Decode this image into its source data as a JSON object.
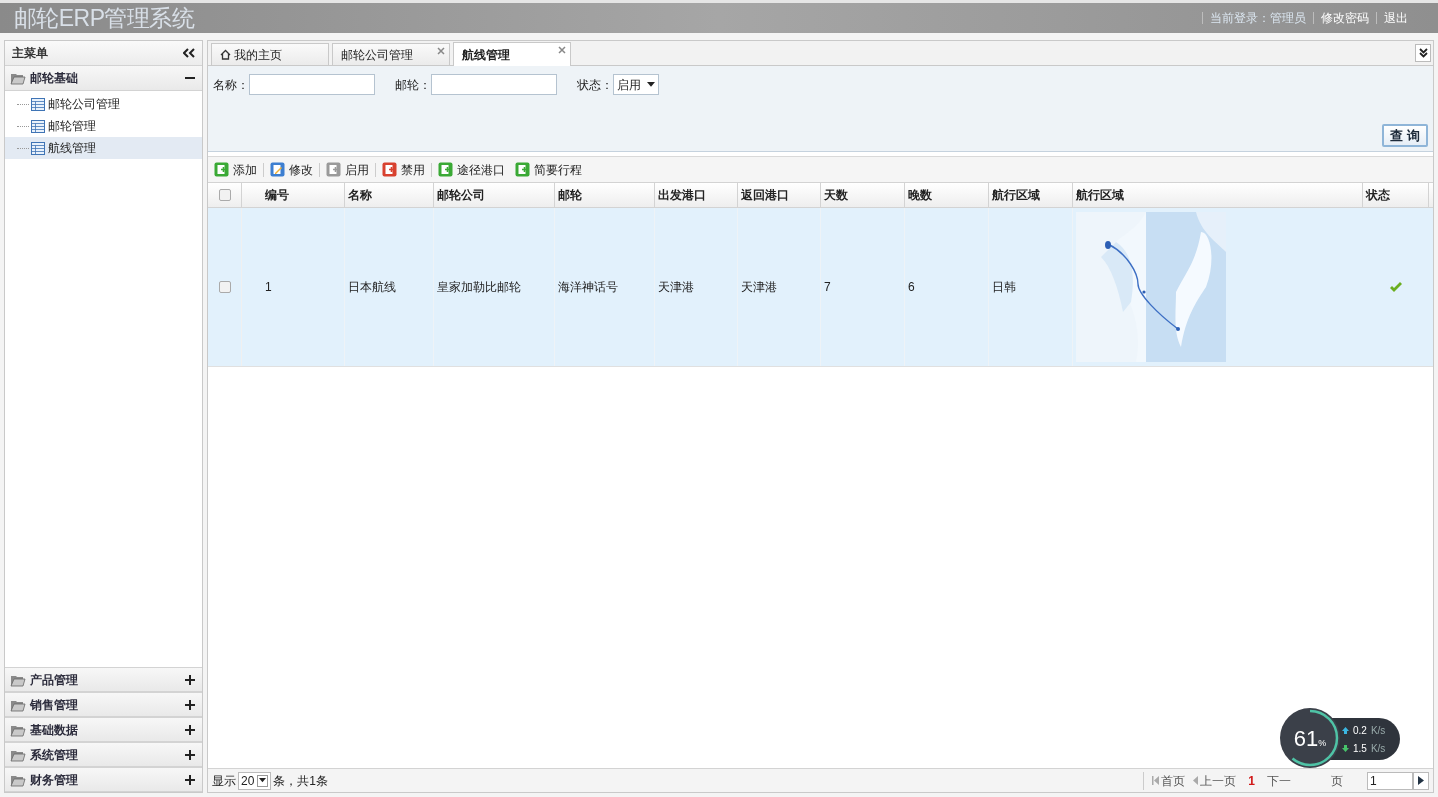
{
  "header": {
    "title": "邮轮ERP管理系统",
    "user_label": "当前登录：管理员",
    "links": [
      "修改密码",
      "退出"
    ]
  },
  "sidebar": {
    "title": "主菜单",
    "groups": [
      {
        "label": "邮轮基础",
        "expanded": true,
        "items": [
          {
            "label": "邮轮公司管理",
            "selected": false
          },
          {
            "label": "邮轮管理",
            "selected": false
          },
          {
            "label": "航线管理",
            "selected": true
          }
        ]
      },
      {
        "label": "产品管理",
        "expanded": false
      },
      {
        "label": "销售管理",
        "expanded": false
      },
      {
        "label": "基础数据",
        "expanded": false
      },
      {
        "label": "系统管理",
        "expanded": false
      },
      {
        "label": "财务管理",
        "expanded": false
      }
    ]
  },
  "tabs": [
    {
      "label": "我的主页",
      "kind": "home",
      "selected": false,
      "closable": false
    },
    {
      "label": "邮轮公司管理",
      "kind": "page",
      "selected": false,
      "closable": true
    },
    {
      "label": "航线管理",
      "kind": "page",
      "selected": true,
      "closable": true
    }
  ],
  "search": {
    "fields": [
      {
        "label": "名称：",
        "kind": "text"
      },
      {
        "label": "邮轮：",
        "kind": "text"
      },
      {
        "label": "状态：",
        "kind": "select",
        "value": "启用"
      }
    ],
    "button": "查 询"
  },
  "toolbar": [
    {
      "label": "添加",
      "kind": "add"
    },
    {
      "label": "修改",
      "kind": "edit"
    },
    {
      "label": "启用",
      "kind": "enable"
    },
    {
      "label": "禁用",
      "kind": "disable"
    },
    {
      "label": "途径港口",
      "kind": "add"
    },
    {
      "label": "简要行程",
      "kind": "add"
    }
  ],
  "table": {
    "all_checked": false,
    "columns": [
      "编号",
      "名称",
      "邮轮公司",
      "邮轮",
      "出发港口",
      "返回港口",
      "天数",
      "晚数",
      "航行区域",
      "航行区域",
      "状态"
    ],
    "rows": [
      {
        "checked": false,
        "highlighted": true,
        "cells": [
          "1",
          "日本航线",
          "皇家加勒比邮轮",
          "海洋神话号",
          "天津港",
          "天津港",
          "7",
          "6",
          "日韩"
        ],
        "enabled": true
      }
    ]
  },
  "footer": {
    "show": "显示",
    "page_size": "20",
    "total": "条，共1条",
    "pager": [
      {
        "label": "首页",
        "kind": "first"
      },
      {
        "label": "上一页",
        "kind": "prev"
      },
      {
        "label": "1",
        "kind": "current"
      },
      {
        "label": "下一",
        "kind": "next"
      },
      {
        "label": "页",
        "kind": "last"
      }
    ],
    "page_input": "1"
  },
  "meter": {
    "percent": "61",
    "unit": "%",
    "up": "0.2",
    "up_unit": "K/s",
    "down": "1.5",
    "down_unit": "K/s"
  }
}
